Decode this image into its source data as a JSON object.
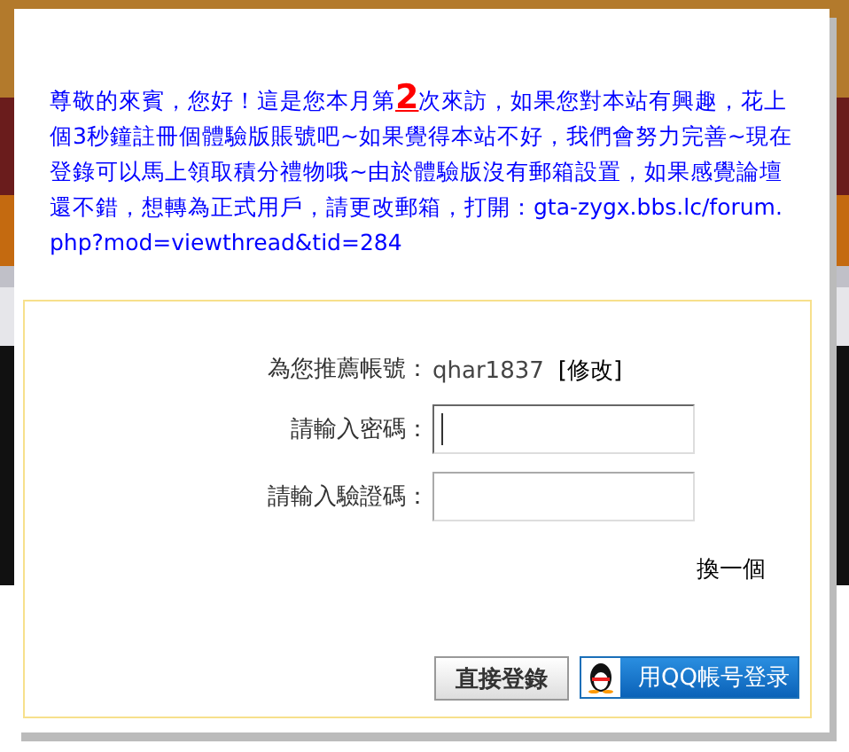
{
  "notice": {
    "before": "尊敬的來賓，您好！這是您本月第",
    "visit_count": "2",
    "after": "次來訪，如果您對本站有興趣，花上個3秒鐘註冊個體驗版賬號吧~如果覺得本站不好，我們會努力完善~現在登錄可以馬上領取積分禮物哦~由於體驗版沒有郵箱設置，如果感覺論壇還不錯，想轉為正式用戶，請更改郵箱，打開：gta-zygx.bbs.lc/forum.php?mod=viewthread&tid=284"
  },
  "account": {
    "label": "為您推薦帳號：",
    "value": "qhar1837",
    "edit_link": "[修改]"
  },
  "fields": [
    {
      "label": "請輸入密碼：",
      "focused": true
    },
    {
      "label": "請輸入驗證碼：",
      "focused": false
    }
  ],
  "refresh_link": "換一個",
  "buttons": [
    {
      "kind": "plain",
      "label": "直接登錄"
    },
    {
      "kind": "qq",
      "label": "用QQ帳号登录"
    }
  ]
}
